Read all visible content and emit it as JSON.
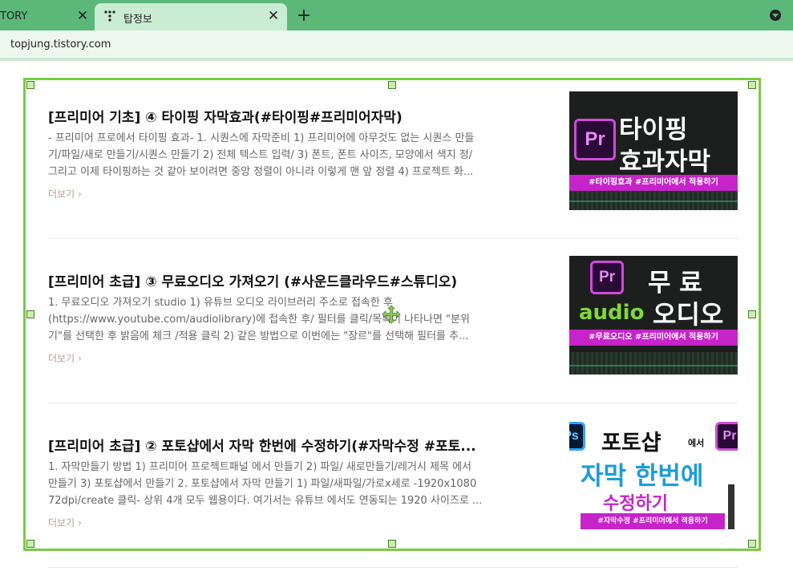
{
  "browser": {
    "tabs": [
      {
        "label": "TORY",
        "active": false
      },
      {
        "label": "탑정보",
        "active": true
      }
    ],
    "close_symbol": "✕",
    "new_tab_symbol": "+",
    "url": "topjung.tistory.com",
    "theme_color": "#5cb878"
  },
  "posts": [
    {
      "title": "[프리미어 기초] ④ 타이핑 자막효과(#타이핑#프리미어자막)",
      "excerpt_lines": [
        "- 프리미어 프로에서 타이핑 효과- 1. 시퀀스에 자막준비 1) 프리미어에 아무것도 없는 시퀀스 만들",
        "기/파일/새로 만들기/시퀀스 만들기 2) 전체 텍스트 입력/ 3) 폰트, 폰트 사이즈, 모양에서 색지 정/",
        "그리고 이제 타이핑하는 것 같아 보이려면 중앙 정렬이 아니라 이렇게 맨 앞 정렬 4) 프로젝트 화..."
      ],
      "more_label": "더보기",
      "more_chevron": "›",
      "thumb": {
        "logo": "Pr",
        "line1": "타이핑",
        "line2": "효과자막",
        "tags": "#타이핑효과 #프리미어에서 적용하기"
      }
    },
    {
      "title": "[프리미어 초급] ③ 무료오디오 가져오기 (#사운드클라우드#스튜디오)",
      "excerpt_lines": [
        "1. 무료오디오 가져오기 studio 1) 유튜브 오디오 라이브러리 주소로 접속한 후",
        "(https://www.youtube.com/audiolibrary)에 접속한 후/ 필터를 클릭/목록이 나타나면 \"분위",
        "기\"를 선택한 후 밝음에 체크 /적용 클릭 2) 같은 방법으로 이번에는 \"장르\"를 선택해 필터를 추..."
      ],
      "more_label": "더보기",
      "more_chevron": "›",
      "thumb": {
        "logo": "Pr",
        "line1": "무 료",
        "line2_a": "audio",
        "line2_b": "오디오",
        "tags": "#무료오디오 #프리미어에서 적용하기"
      }
    },
    {
      "title": "[프리미어 초급] ② 포토샵에서 자막 한번에 수정하기(#자막수정 #포토...",
      "excerpt_lines": [
        "1. 자막만들기 방법 1) 프리미어 프로젝트패널 에서 만들기 2) 파일/ 새로만들기/레거시 제목 에서",
        "만들기 3) 포토샵에서 만들기 2. 포토샵에서 자막 만들기 1) 파일/새파일/가로x세로 -1920x1080",
        "72dpi/create 클릭- 상위 4개 모두 웹용이다. 여기서는 유튜브 에서도 연동되는 1920 사이즈로 ..."
      ],
      "more_label": "더보기",
      "more_chevron": "›",
      "thumb": {
        "logo_ps": "Ps",
        "logo_pr": "Pr",
        "line1": "포토샵",
        "line1_small": "에서",
        "line2": "자막 한번에",
        "line3": "수정하기",
        "tags": "#자막수정 #프리미어에서 적용하기"
      }
    }
  ]
}
